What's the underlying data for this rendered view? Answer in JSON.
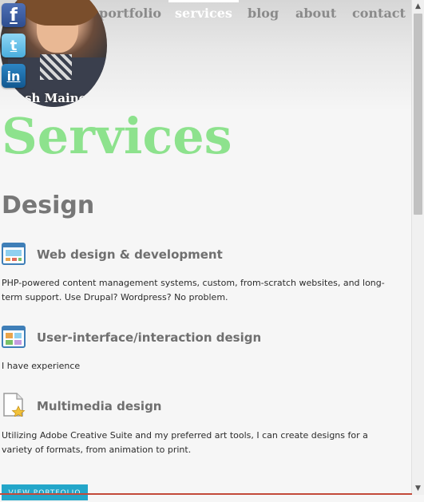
{
  "nav": {
    "items": [
      "portfolio",
      "services",
      "blog",
      "about",
      "contact"
    ],
    "active": "services"
  },
  "profile": {
    "name": "Josh Maines"
  },
  "social": [
    {
      "icon": "facebook-icon",
      "glyph": "f",
      "color": "#3b5998"
    },
    {
      "icon": "twitter-icon",
      "glyph": "t",
      "color": "#55acee"
    },
    {
      "icon": "linkedin-icon",
      "glyph": "in",
      "color": "#0e76a8"
    }
  ],
  "page": {
    "title": "Services",
    "section": "Design"
  },
  "services": [
    {
      "icon": "web-design-icon",
      "title": "Web design & development",
      "description": "PHP-powered content management systems, custom, from-scratch websites, and long-term support. Use Drupal? Wordpress? No problem."
    },
    {
      "icon": "ui-design-icon",
      "title": "User-interface/interaction design",
      "description": "I have experience"
    },
    {
      "icon": "multimedia-icon",
      "title": "Multimedia design",
      "description": "Utilizing Adobe Creative Suite and my preferred art tools, I can create designs for a variety of formats, from animation to print."
    }
  ],
  "cta": {
    "label": "VIEW PORTFOLIO"
  },
  "colors": {
    "title_green": "#8de28d",
    "button_blue": "#23a6c9",
    "heading_gray": "#777777"
  }
}
